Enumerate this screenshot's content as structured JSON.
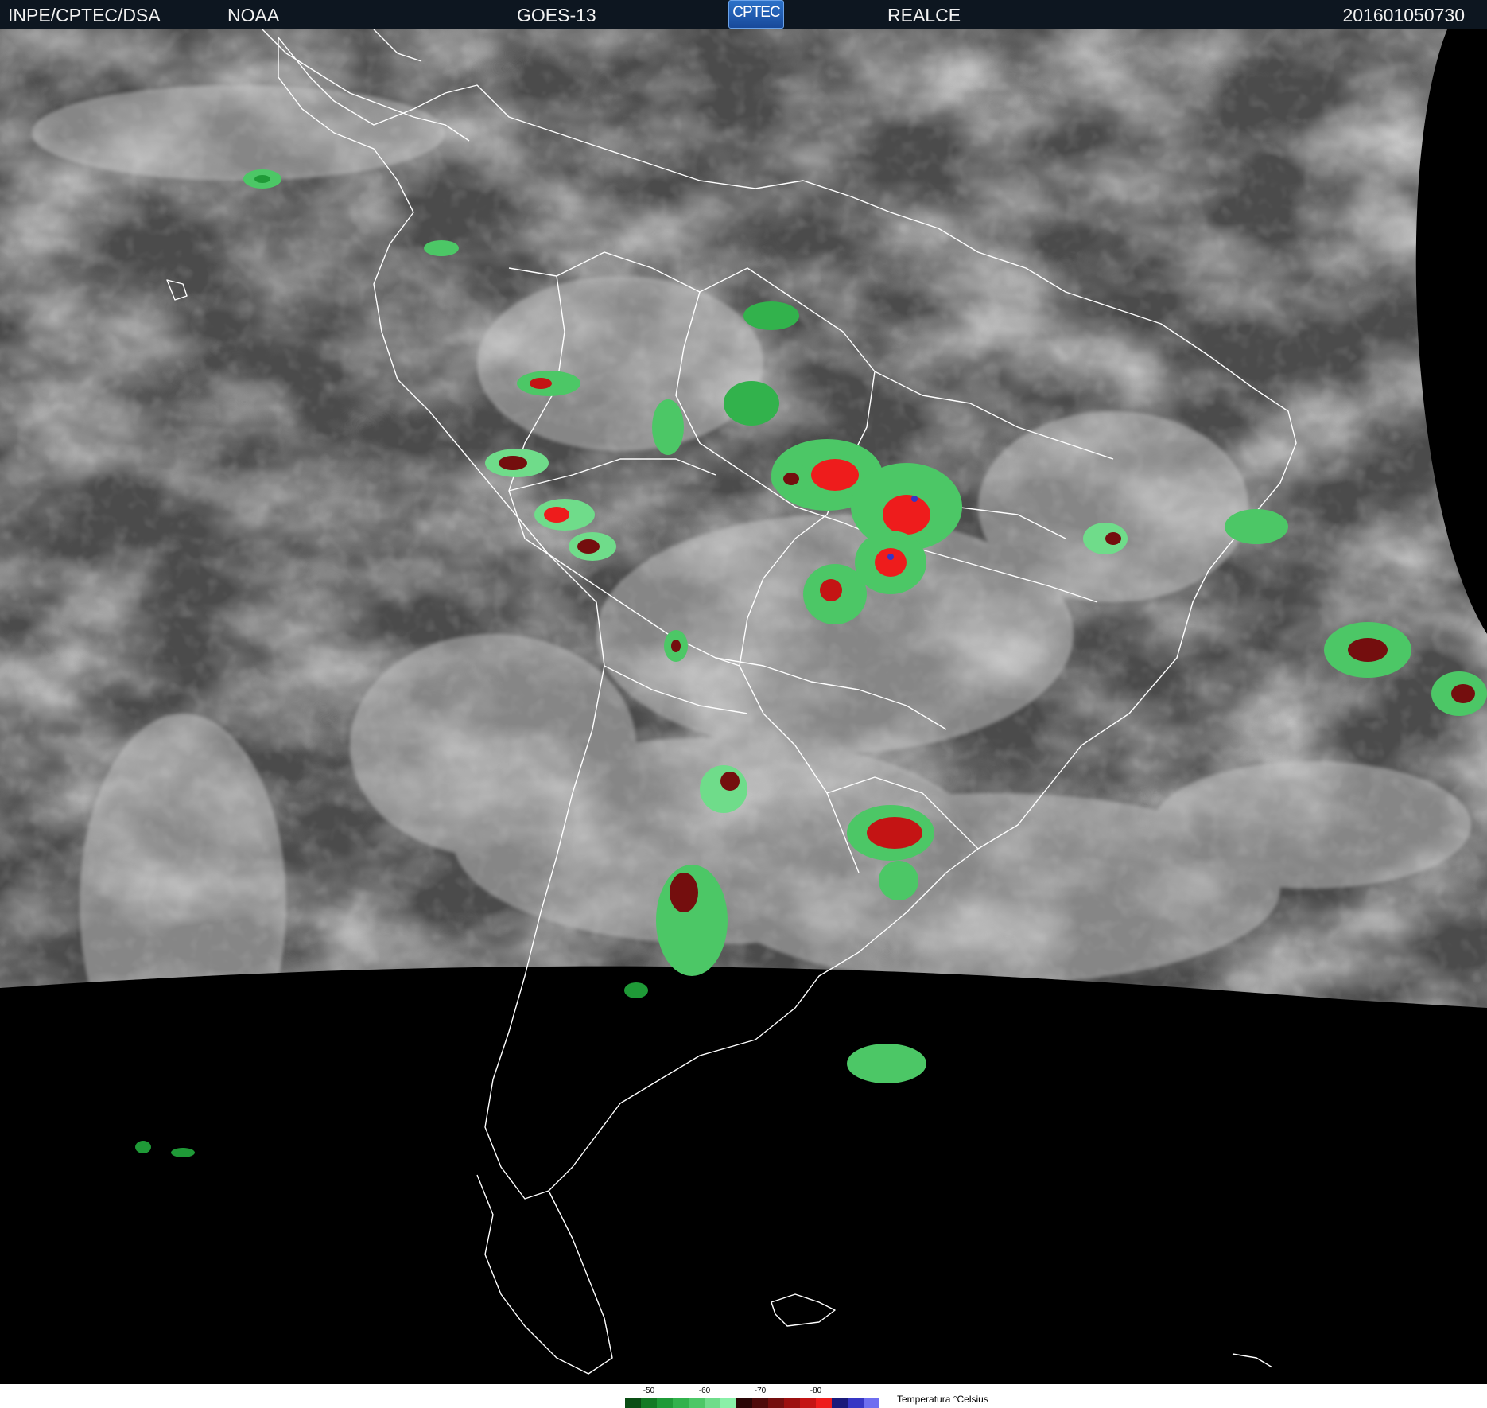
{
  "header": {
    "organization": "INPE/CPTEC/DSA",
    "agency": "NOAA",
    "satellite": "GOES-13",
    "logo_text": "CPTEC",
    "product": "REALCE",
    "timestamp": "201601050730"
  },
  "colors": {
    "header_background": "#0d1620",
    "space": "#000000",
    "coastline": "#ffffff"
  },
  "legend": {
    "title": "Temperatura °Celsius",
    "scale": [
      {
        "color": "#0a4d14"
      },
      {
        "color": "#137a25"
      },
      {
        "color": "#1f9a37"
      },
      {
        "color": "#32b24c"
      },
      {
        "color": "#4cc766"
      },
      {
        "color": "#6fdc8a"
      },
      {
        "color": "#8af0a8"
      },
      {
        "color": "#2a0606"
      },
      {
        "color": "#4e0a0a"
      },
      {
        "color": "#740e0e"
      },
      {
        "color": "#9c0f0f"
      },
      {
        "color": "#c41414"
      },
      {
        "color": "#ee1c1c"
      },
      {
        "color": "#1a1a7a"
      },
      {
        "color": "#3636c4"
      },
      {
        "color": "#6e6ef0"
      }
    ],
    "ticks": [
      {
        "label": "-50",
        "index": 1.5
      },
      {
        "label": "-60",
        "index": 5.0
      },
      {
        "label": "-70",
        "index": 8.5
      },
      {
        "label": "-80",
        "index": 12.0
      }
    ]
  }
}
